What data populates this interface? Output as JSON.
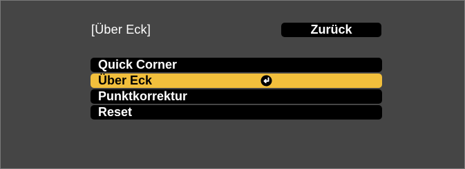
{
  "screen": {
    "title": "[Über Eck]",
    "back_label": "Zurück"
  },
  "menu": {
    "items": [
      {
        "label": "Quick Corner",
        "selected": false
      },
      {
        "label": "Über Eck",
        "selected": true,
        "icon": "enter-icon"
      },
      {
        "label": "Punktkorrektur",
        "selected": false
      },
      {
        "label": "Reset",
        "selected": false
      }
    ]
  },
  "colors": {
    "panel_background": "#454545",
    "item_background": "#000000",
    "selected_background": "#f2bf3c",
    "text_light": "#ffffff",
    "text_dark": "#000000"
  }
}
